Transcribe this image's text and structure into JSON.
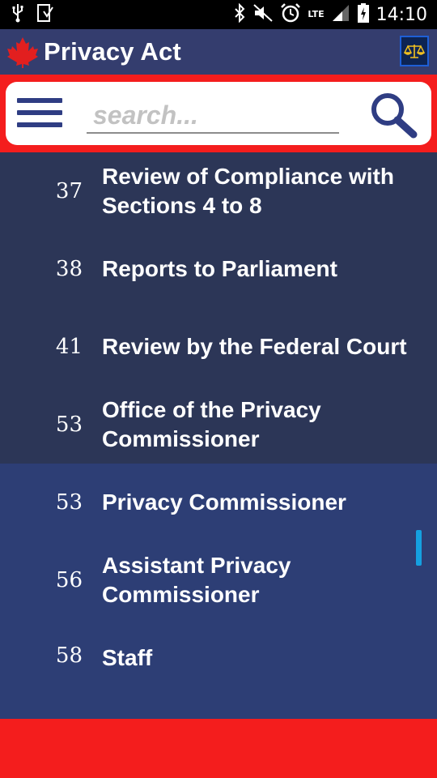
{
  "status_bar": {
    "time": "14:10",
    "network": "LTE",
    "icons": [
      "usb-icon",
      "download-icon",
      "bluetooth-icon",
      "mute-icon",
      "alarm-icon",
      "signal-icon",
      "battery-icon"
    ]
  },
  "app_bar": {
    "title": "Privacy Act",
    "logo": "maple-leaf-icon",
    "action_icon": "scales-of-justice-icon"
  },
  "search": {
    "placeholder": "search..."
  },
  "sections": [
    {
      "number": "37",
      "title": "Review of Compliance with Sections 4 to 8"
    },
    {
      "number": "38",
      "title": "Reports to Parliament"
    },
    {
      "number": "41",
      "title": "Review by the Federal Court"
    },
    {
      "number": "53",
      "title": "Office of the Privacy Commissioner"
    },
    {
      "number": "53",
      "title": "Privacy Commissioner"
    },
    {
      "number": "56",
      "title": "Assistant Privacy Commissioner"
    },
    {
      "number": "58",
      "title": "Staff"
    }
  ],
  "colors": {
    "header": "#343d6e",
    "accent_red": "#f41d1d",
    "list_dark": "#2c3657",
    "list_blue": "#2d3e75",
    "icon_blue": "#2f3d83",
    "scrollbar": "#15a0e0"
  }
}
